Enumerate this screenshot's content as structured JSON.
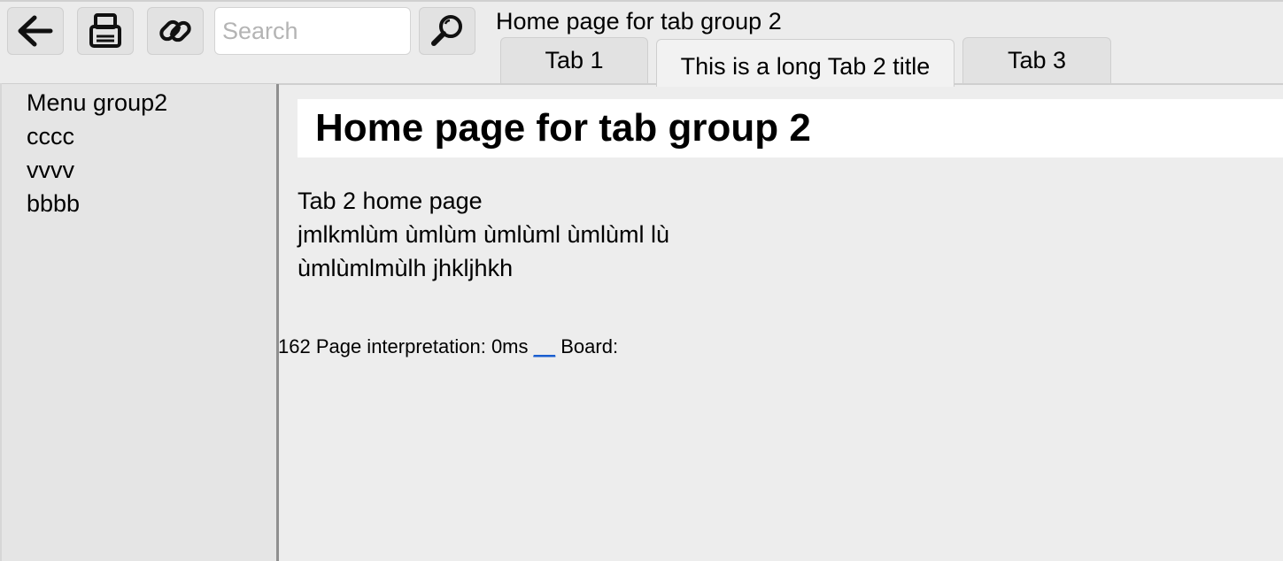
{
  "toolbar": {
    "back_icon": "arrow-left-icon",
    "print_icon": "printer-icon",
    "link_icon": "chain-link-icon",
    "search": {
      "placeholder": "Search",
      "value": ""
    },
    "search_icon": "magnifier-icon"
  },
  "page_caption": "Home page for tab group 2",
  "tabs": [
    {
      "label": "Tab 1",
      "active": false
    },
    {
      "label": "This is a long Tab 2 title",
      "active": true
    },
    {
      "label": "Tab 3",
      "active": false
    }
  ],
  "sidebar": {
    "title": "Menu group2",
    "items": [
      {
        "label": "cccc"
      },
      {
        "label": "vvvv"
      },
      {
        "label": "bbbb"
      }
    ]
  },
  "main": {
    "heading": "Home page for tab group 2",
    "lines": [
      "Tab 2 home page",
      "jmlkmlùm ùmlùm ùmlùml ùmlùml lù",
      "ùmlùmlmùlh jhkljhkh"
    ]
  },
  "status": {
    "prefix": "162 Page interpretation: 0ms",
    "link": "__",
    "suffix": "Board:"
  },
  "colors": {
    "background": "#ededed",
    "toolbar": "#ececec",
    "sidebar": "#e5e5e5",
    "divider": "#8f8f8f",
    "link": "#1a5fd0"
  }
}
